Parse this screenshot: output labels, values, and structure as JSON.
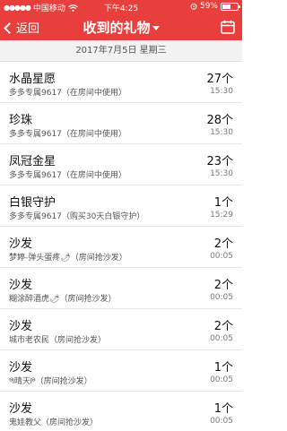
{
  "status_bar": {
    "carrier": "中国移动",
    "time": "下午4:25",
    "battery": "59%",
    "battery_level": 0.59
  },
  "nav": {
    "back_label": "返回",
    "title": "收到的礼物"
  },
  "date_header": "2017年7月5日 星期三",
  "gifts": [
    {
      "name": "水晶星愿",
      "sender": "多多专属9617",
      "note": "（在房间中使用）",
      "count": "27个",
      "time": "15:30"
    },
    {
      "name": "珍珠",
      "sender": "多多专属9617",
      "note": "（在房间中使用）",
      "count": "28个",
      "time": "15:30"
    },
    {
      "name": "凤冠金星",
      "sender": "多多专属9617",
      "note": "（在房间中使用）",
      "count": "23个",
      "time": "15:30"
    },
    {
      "name": "白银守护",
      "sender": "多多专属9617",
      "note": "（购买30天白银守护）",
      "count": "1个",
      "time": "15:29"
    },
    {
      "name": "沙发",
      "sender": "梦婷-弹头蛋疼🌶",
      "note": "（房间抢沙发）",
      "count": "2个",
      "time": "00:05"
    },
    {
      "name": "沙发",
      "sender": "糊涂醉酒虎🌶",
      "note": "（房间抢沙发）",
      "count": "2个",
      "time": "00:05"
    },
    {
      "name": "沙发",
      "sender": "城市老农民",
      "note": "（房间抢沙发）",
      "count": "2个",
      "time": "00:05"
    },
    {
      "name": "沙发",
      "sender": "ᖗ晴天ᖘ",
      "note": "（房间抢沙发）",
      "count": "1个",
      "time": "00:05"
    },
    {
      "name": "沙发",
      "sender": "鬼娃教父",
      "note": "（房间抢沙发）",
      "count": "1个",
      "time": "00:05"
    }
  ]
}
